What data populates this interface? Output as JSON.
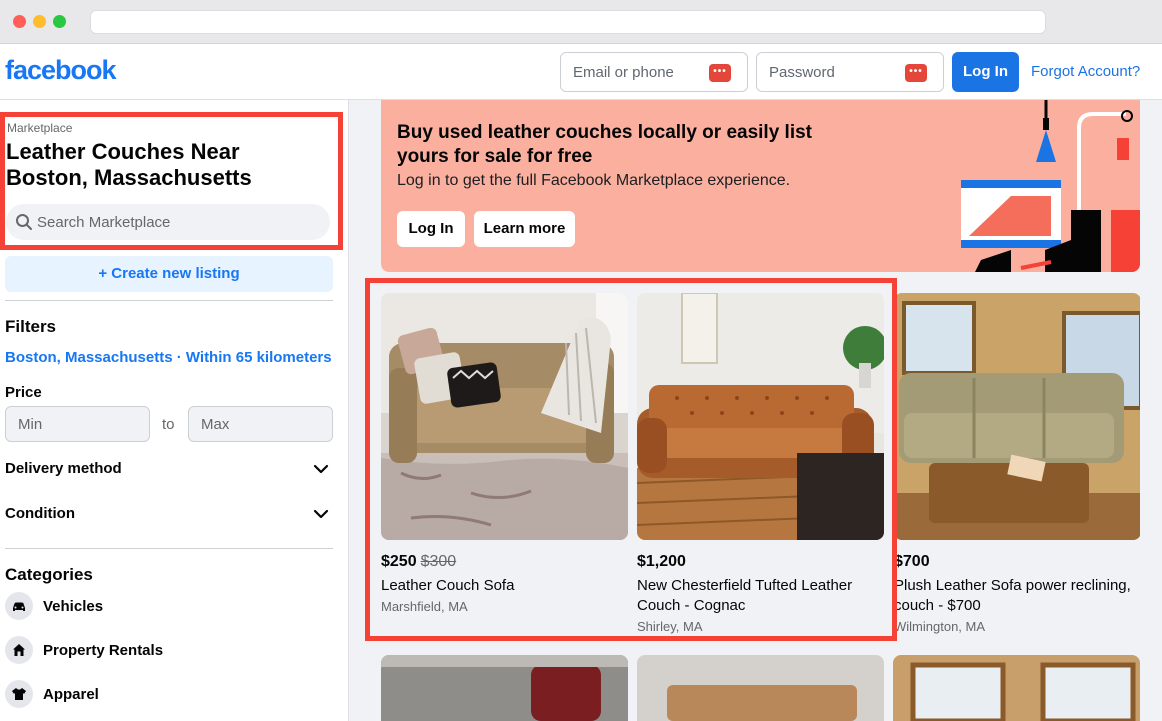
{
  "header": {
    "logo": "facebook",
    "email_placeholder": "Email or phone",
    "password_placeholder": "Password",
    "login_label": "Log In",
    "forgot_label": "Forgot Account?",
    "key_icon_glyph": "•••",
    "brand_color": "#1877f2"
  },
  "sidebar": {
    "breadcrumb": "Marketplace",
    "title": "Leather Couches Near Boston, Massachusetts",
    "search_placeholder": "Search Marketplace",
    "create_label": "+ Create new listing",
    "filters_heading": "Filters",
    "location_text": "Boston, Massachusetts · Within 65 kilometers",
    "price_heading": "Price",
    "price_min_placeholder": "Min",
    "price_to": "to",
    "price_max_placeholder": "Max",
    "delivery_label": "Delivery method",
    "condition_label": "Condition",
    "categories_heading": "Categories",
    "categories": [
      {
        "label": "Vehicles",
        "icon": "car-icon"
      },
      {
        "label": "Property Rentals",
        "icon": "house-icon"
      },
      {
        "label": "Apparel",
        "icon": "shirt-icon"
      }
    ]
  },
  "banner": {
    "title": "Buy used leather couches locally or easily list yours for sale for free",
    "subtitle": "Log in to get the full Facebook Marketplace experience.",
    "login_label": "Log In",
    "learn_label": "Learn more",
    "bg_color": "#fbaf9f"
  },
  "listings": [
    {
      "price": "$250",
      "old_price": "$300",
      "title": "Leather Couch Sofa",
      "location": "Marshfield, MA"
    },
    {
      "price": "$1,200",
      "old_price": "",
      "title": "New Chesterfield Tufted Leather Couch - Cognac",
      "location": "Shirley, MA"
    },
    {
      "price": "$700",
      "old_price": "",
      "title": "Plush Leather Sofa power reclining, couch - $700",
      "location": "Wilmington, MA"
    }
  ],
  "annotation_color": "#f64137"
}
